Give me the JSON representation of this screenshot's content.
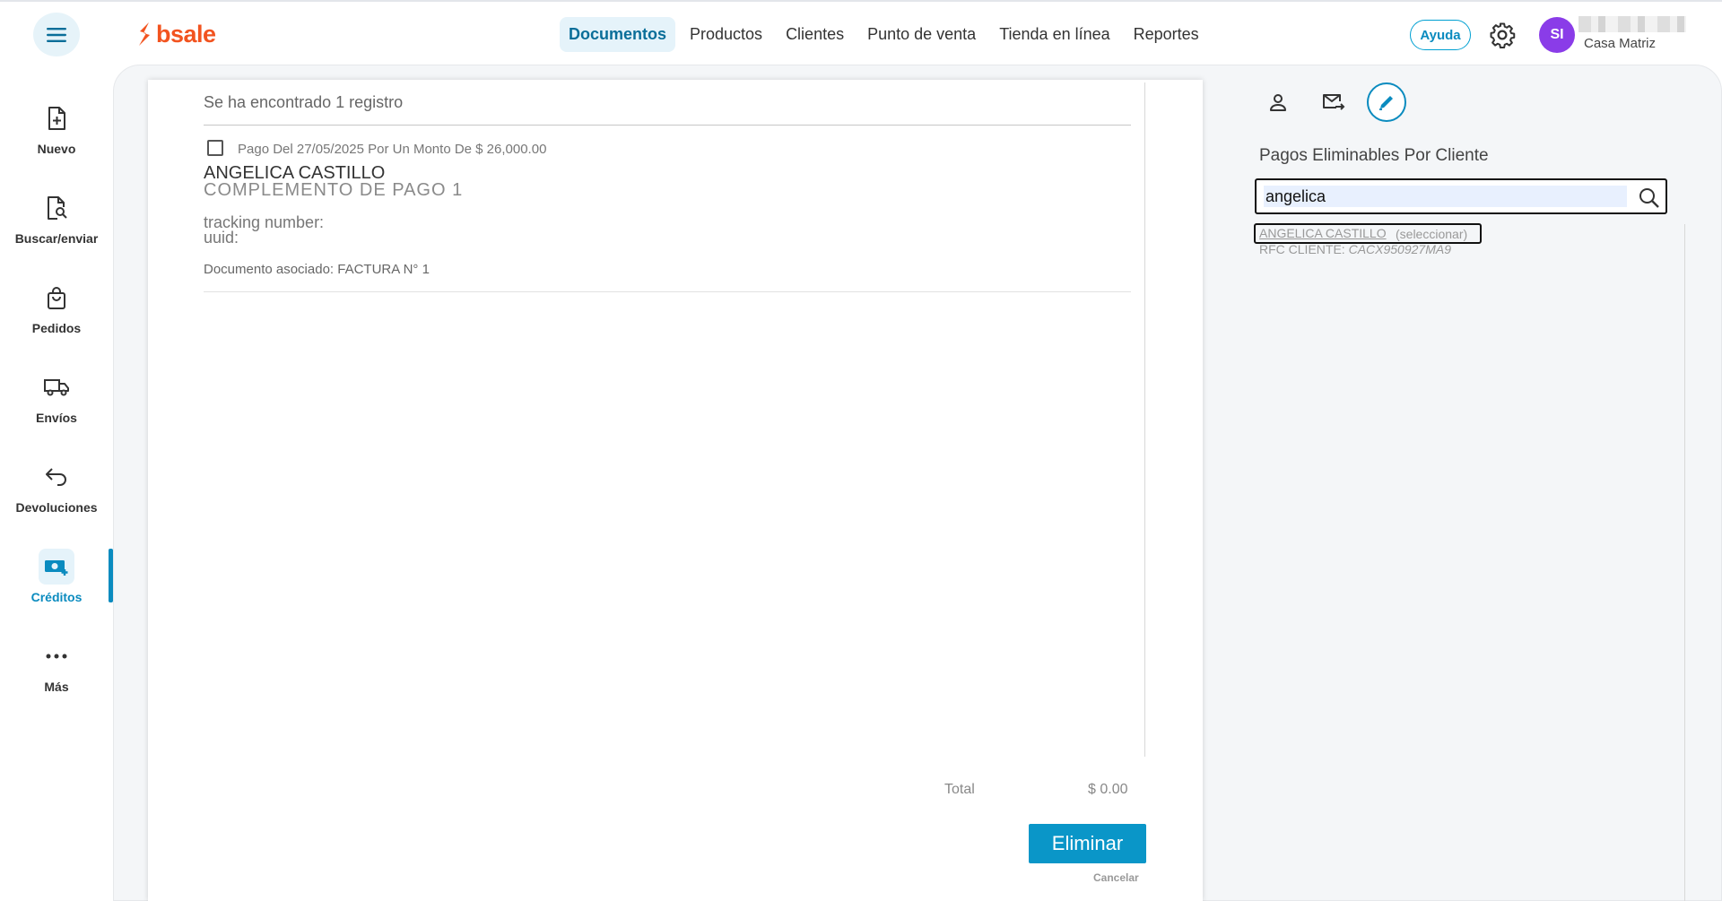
{
  "app": {
    "logo_text": "bsale",
    "accent_color": "#0a8bbf",
    "brand_color": "#f2531f"
  },
  "nav": {
    "items": [
      {
        "label": "Documentos",
        "active": true
      },
      {
        "label": "Productos",
        "active": false
      },
      {
        "label": "Clientes",
        "active": false
      },
      {
        "label": "Punto de venta",
        "active": false
      },
      {
        "label": "Tienda en línea",
        "active": false
      },
      {
        "label": "Reportes",
        "active": false
      }
    ]
  },
  "header": {
    "help_label": "Ayuda",
    "avatar_initials": "SI",
    "branch": "Casa Matriz"
  },
  "sidebar": {
    "items": [
      {
        "label": "Nuevo",
        "icon": "new-document-icon",
        "active": false
      },
      {
        "label": "Buscar/enviar",
        "icon": "search-document-icon",
        "active": false
      },
      {
        "label": "Pedidos",
        "icon": "shopping-bag-icon",
        "active": false
      },
      {
        "label": "Envíos",
        "icon": "truck-icon",
        "active": false
      },
      {
        "label": "Devoluciones",
        "icon": "return-arrow-icon",
        "active": false
      },
      {
        "label": "Créditos",
        "icon": "money-plus-icon",
        "active": true
      },
      {
        "label": "Más",
        "icon": "more-dots-icon",
        "active": false
      }
    ]
  },
  "document": {
    "found_text": "Se ha encontrado 1 registro",
    "payment_line": "Pago Del 27/05/2025 Por Un Monto De $ 26,000.00",
    "customer_name": "ANGELICA CASTILLO",
    "complement": "COMPLEMENTO DE PAGO 1",
    "tracking_label": "tracking number:",
    "uuid_label": "uuid:",
    "associated": "Documento asociado: FACTURA N° 1",
    "total_label": "Total",
    "total_value": "$ 0.00",
    "delete_label": "Eliminar",
    "cancel_label": "Cancelar"
  },
  "right_panel": {
    "title": "Pagos Eliminables Por Cliente",
    "search_value": "angelica",
    "result_name": "ANGELICA CASTILLO",
    "result_select": "(seleccionar)",
    "rfc_label": "RFC CLIENTE:",
    "rfc_value": "CACX950927MA9"
  }
}
